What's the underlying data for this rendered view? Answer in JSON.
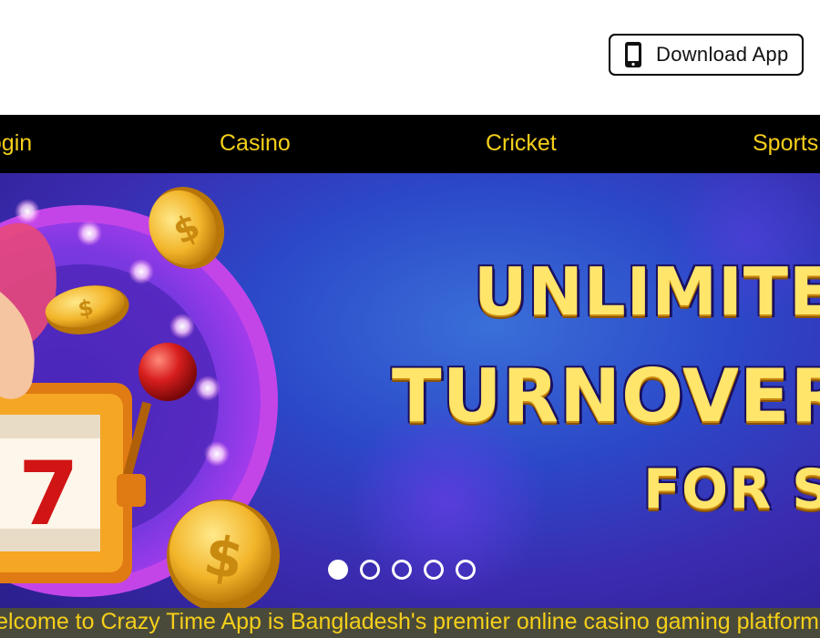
{
  "header": {
    "download_button": {
      "label": "Download App",
      "icon": "smartphone-icon"
    }
  },
  "nav": {
    "items": [
      {
        "label": "Login"
      },
      {
        "label": "Casino"
      },
      {
        "label": "Cricket"
      },
      {
        "label": "Sports"
      }
    ]
  },
  "banner": {
    "headline_1": "UNLIMITED",
    "headline_2": "TURNOVER",
    "headline_3": "FOR S",
    "slides_count": 5,
    "active_slide": 1
  },
  "ticker": {
    "text": "Welcome to Crazy Time App is Bangladesh's premier online casino gaming platform"
  },
  "colors": {
    "nav_bg": "#000000",
    "nav_text": "#f5cf1a",
    "ticker_bg": "#4a4a3a",
    "banner_bg": "#3b2bb0",
    "headline": "#ffe56a"
  }
}
